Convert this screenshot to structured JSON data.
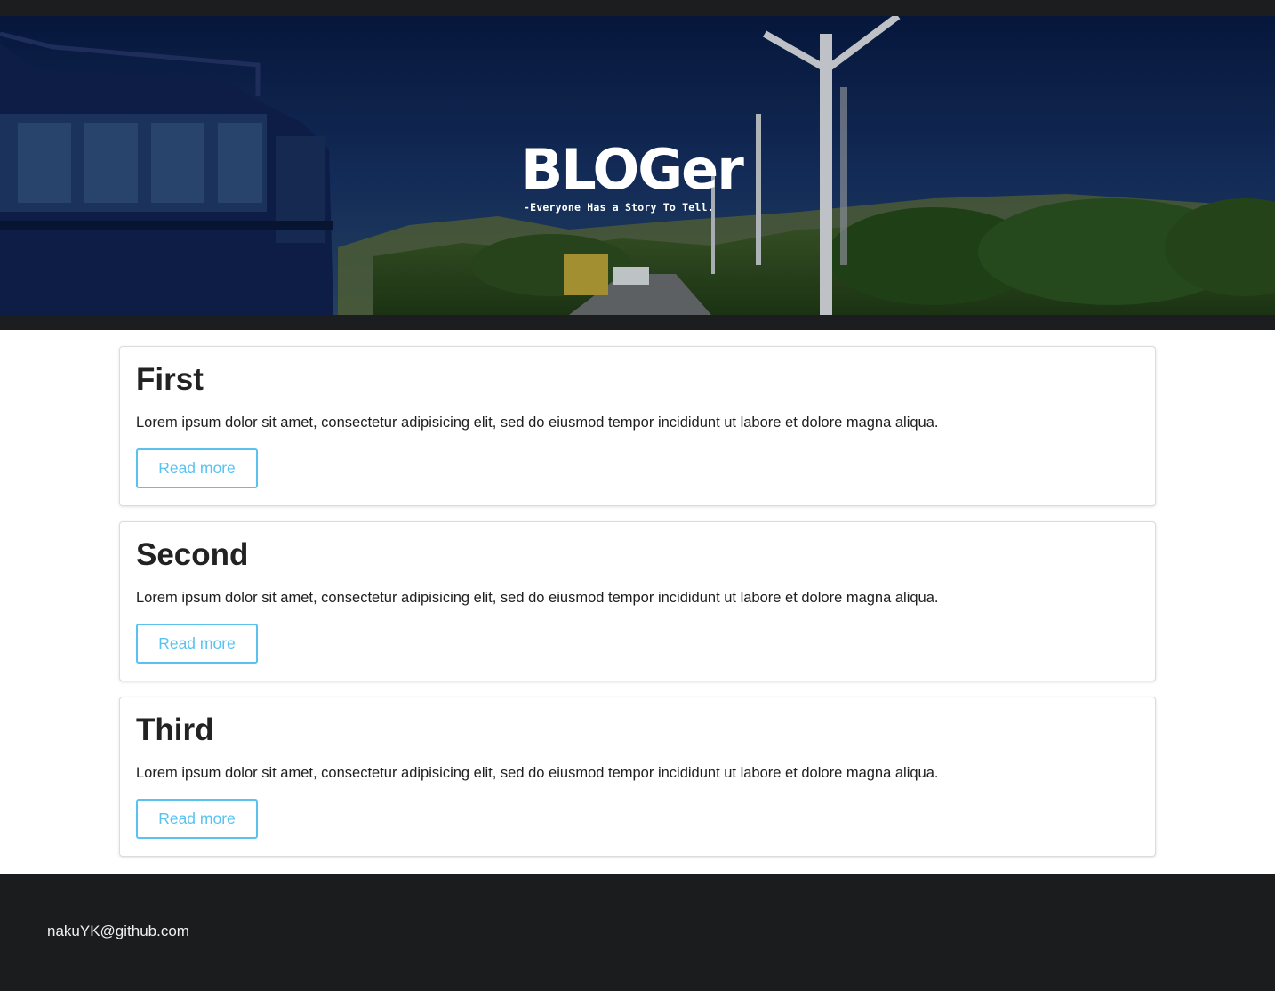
{
  "hero": {
    "title": "BLOGer",
    "tagline": "-Everyone Has a Story To Tell."
  },
  "posts": [
    {
      "title": "First",
      "text": "Lorem ipsum dolor sit amet, consectetur adipisicing elit, sed do eiusmod tempor incididunt ut labore et dolore magna aliqua.",
      "button": "Read more"
    },
    {
      "title": "Second",
      "text": "Lorem ipsum dolor sit amet, consectetur adipisicing elit, sed do eiusmod tempor incididunt ut labore et dolore magna aliqua.",
      "button": "Read more"
    },
    {
      "title": "Third",
      "text": "Lorem ipsum dolor sit amet, consectetur adipisicing elit, sed do eiusmod tempor incididunt ut labore et dolore magna aliqua.",
      "button": "Read more"
    }
  ],
  "footer": {
    "text": "nakuYK@github.com"
  },
  "colors": {
    "accent": "#59c3f0",
    "dark": "#1c1d1f"
  }
}
